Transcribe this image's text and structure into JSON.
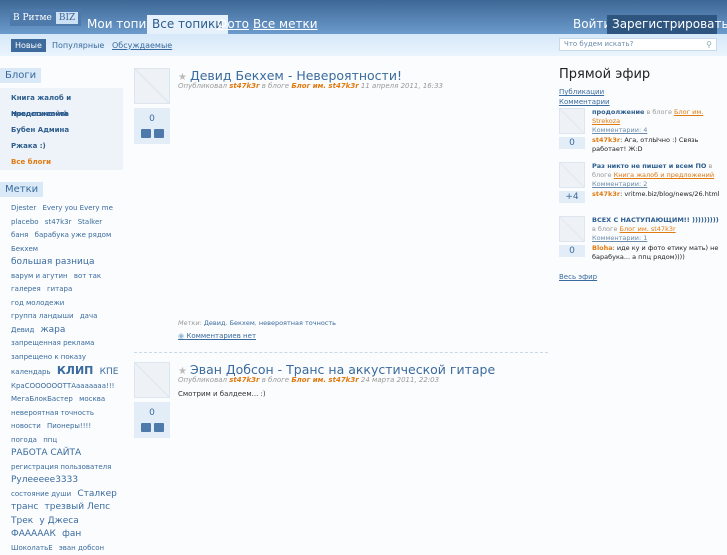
{
  "header": {
    "logo_text": "В Ритме",
    "logo_badge": "BIZ",
    "tabs": [
      {
        "label": "Мои топики"
      },
      {
        "label": "Все топики"
      },
      {
        "label": "Фото"
      },
      {
        "label": "Все метки"
      }
    ],
    "login": "Войти",
    "register": "Зарегистрироваться"
  },
  "subnav": {
    "items": [
      {
        "label": "Новые"
      },
      {
        "label": "Популярные"
      },
      {
        "label": "Обсуждаемые"
      }
    ],
    "search_placeholder": "Что будем искать?"
  },
  "sidebar": {
    "blogs_title": "Блоги",
    "blogs": [
      "Книга жалоб и предложений",
      "Новости сайта",
      "Бубен Админа",
      "Ржака :)",
      "Все блоги"
    ],
    "tags_title": "Метки",
    "tags": [
      "Djester",
      "Every you Every me",
      "placebo",
      "st47k3r",
      "Stalker",
      "баня",
      "барабука уже рядом",
      "Бекхем",
      "большая разница",
      "варум и агутин",
      "вот так",
      "галерея",
      "гитара",
      "год молодежи",
      "группа ландыши",
      "дача",
      "Девид",
      "жара",
      "запрещенная реклама",
      "запрещено к показу",
      "календарь",
      "КЛИП",
      "КПЕ",
      "КраСООООООТТАааааааа!!!",
      "МегаБлокБастер",
      "москва",
      "невероятная точность",
      "новости",
      "Пионеры!!!!",
      "погода",
      "ппц",
      "РАБОТА САЙТА",
      "регистрация пользователя",
      "Рулеееее3333",
      "состояние души",
      "Сталкер",
      "транс",
      "трезвый Лепс",
      "Трек",
      "у Джеса",
      "ФАААААК",
      "фан",
      "ШоколатьЕ",
      "эван добсон"
    ]
  },
  "articles": [
    {
      "title": "Девид Бекхем - Невероятности!",
      "published": "Опубликовал",
      "author": "st47k3r",
      "in_blog": "в блоге",
      "blog": "Блог им. st47k3r",
      "date": "11 апреля 2011, 16:33",
      "votes": "0",
      "tags_label": "Метки:",
      "tags": [
        "Девид",
        "Бекхем",
        "невероятная точность"
      ],
      "comments": "Комментариев нет"
    },
    {
      "title": "Эван Добсон - Транс на аккустической гитаре",
      "published": "Опубликовал",
      "author": "st47k3r",
      "in_blog": "в блоге",
      "blog": "Блог им. st47k3r",
      "date": "24 марта 2011, 22:03",
      "votes": "0",
      "body": "Смотрим и балдеем... :)"
    }
  ],
  "live": {
    "title": "Прямой эфир",
    "tab_publications": "Публикации",
    "tab_comments": "Комментарии",
    "in_blog": "в блоге",
    "items": [
      {
        "topic": "продолжение",
        "blog": "Блог им. Strekoza",
        "comments": "Комментарии: 4",
        "count": "0",
        "user": "st47k3r",
        "text": ": Ага, отлЫчно :) Связь работает! Ж:D"
      },
      {
        "topic": "Раз никто не пишет и всем ПО",
        "blog": "Книга жалоб и предложений",
        "comments": "Комментарии: 2",
        "count": "+4",
        "user": "st47k3r",
        "text": ": vritme.biz/blog/news/26.html"
      },
      {
        "topic": "ВСЕХ С НАСТУПАЮЩИМ!! )))))))))",
        "blog": "Блог им. st47k3r",
        "comments": "Комментарии: 1",
        "count": "0",
        "user": "Bloha",
        "text": ": иде ку и фото етику мать) не барабука... а ппц рядом))))"
      }
    ],
    "all": "Весь эфир"
  }
}
